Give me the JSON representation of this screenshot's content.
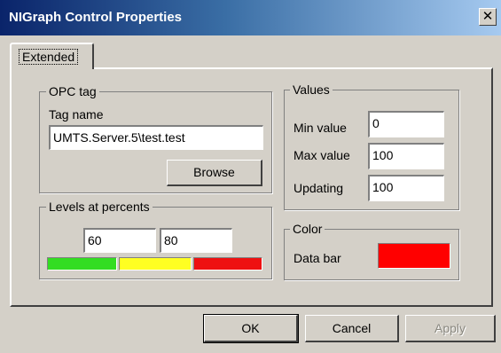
{
  "window": {
    "title": "NIGraph Control Properties",
    "close_glyph": "✕"
  },
  "tabs": [
    {
      "label": "Extended",
      "selected": true
    }
  ],
  "opc_tag": {
    "group_label": "OPC tag",
    "tag_name_label": "Tag name",
    "tag_name_value": "UMTS.Server.5\\test.test",
    "browse_label": "Browse"
  },
  "levels": {
    "group_label": "Levels at percents",
    "level1_value": "60",
    "level2_value": "80",
    "colors": [
      "#33dd22",
      "#ffff22",
      "#ee1111"
    ]
  },
  "values": {
    "group_label": "Values",
    "min_label": "Min value",
    "min_value": "0",
    "max_label": "Max value",
    "max_value": "100",
    "updating_label": "Updating",
    "updating_value": "100"
  },
  "color": {
    "group_label": "Color",
    "data_bar_label": "Data bar",
    "data_bar_color": "#ff0000"
  },
  "buttons": {
    "ok_label": "OK",
    "cancel_label": "Cancel",
    "apply_label": "Apply"
  }
}
